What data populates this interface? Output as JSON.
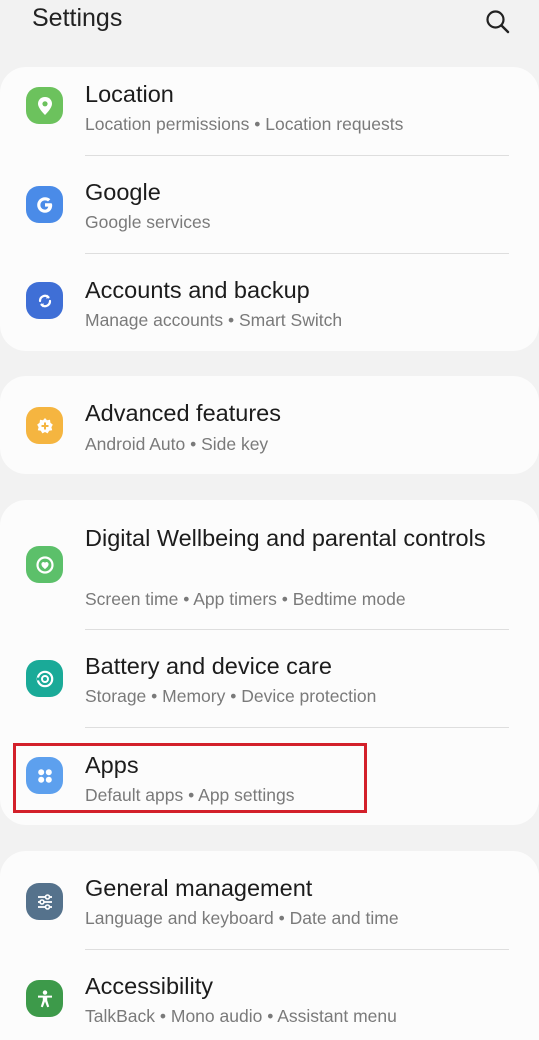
{
  "header": {
    "title": "Settings",
    "search_icon": "search-icon"
  },
  "colors": {
    "location": "#6cc25d",
    "google": "#4a8be8",
    "accounts": "#3f6fd6",
    "advanced": "#f5b540",
    "wellbeing": "#5cc06a",
    "battery": "#1aaa98",
    "apps": "#5da0ee",
    "general": "#55728c",
    "accessibility": "#3d9a4a",
    "highlight": "#d3202a"
  },
  "items": [
    {
      "title": "Location",
      "subtitle": "Location permissions  •  Location requests",
      "icon": "location-pin-icon"
    },
    {
      "title": "Google",
      "subtitle": "Google services",
      "icon": "google-icon"
    },
    {
      "title": "Accounts and backup",
      "subtitle": "Manage accounts  •  Smart Switch",
      "icon": "sync-icon"
    },
    {
      "title": "Advanced features",
      "subtitle": "Android Auto  •  Side key",
      "icon": "gear-plus-icon"
    },
    {
      "title": "Digital Wellbeing and parental controls",
      "subtitle": "Screen time  •  App timers  •  Bedtime mode",
      "icon": "wellbeing-heart-icon"
    },
    {
      "title": "Battery and device care",
      "subtitle": "Storage  •  Memory  •  Device protection",
      "icon": "device-care-icon"
    },
    {
      "title": "Apps",
      "subtitle": "Default apps  •  App settings",
      "icon": "apps-grid-icon"
    },
    {
      "title": "General management",
      "subtitle": "Language and keyboard  •  Date and time",
      "icon": "sliders-icon"
    },
    {
      "title": "Accessibility",
      "subtitle": "TalkBack  •  Mono audio  •  Assistant menu",
      "icon": "accessibility-person-icon"
    }
  ]
}
